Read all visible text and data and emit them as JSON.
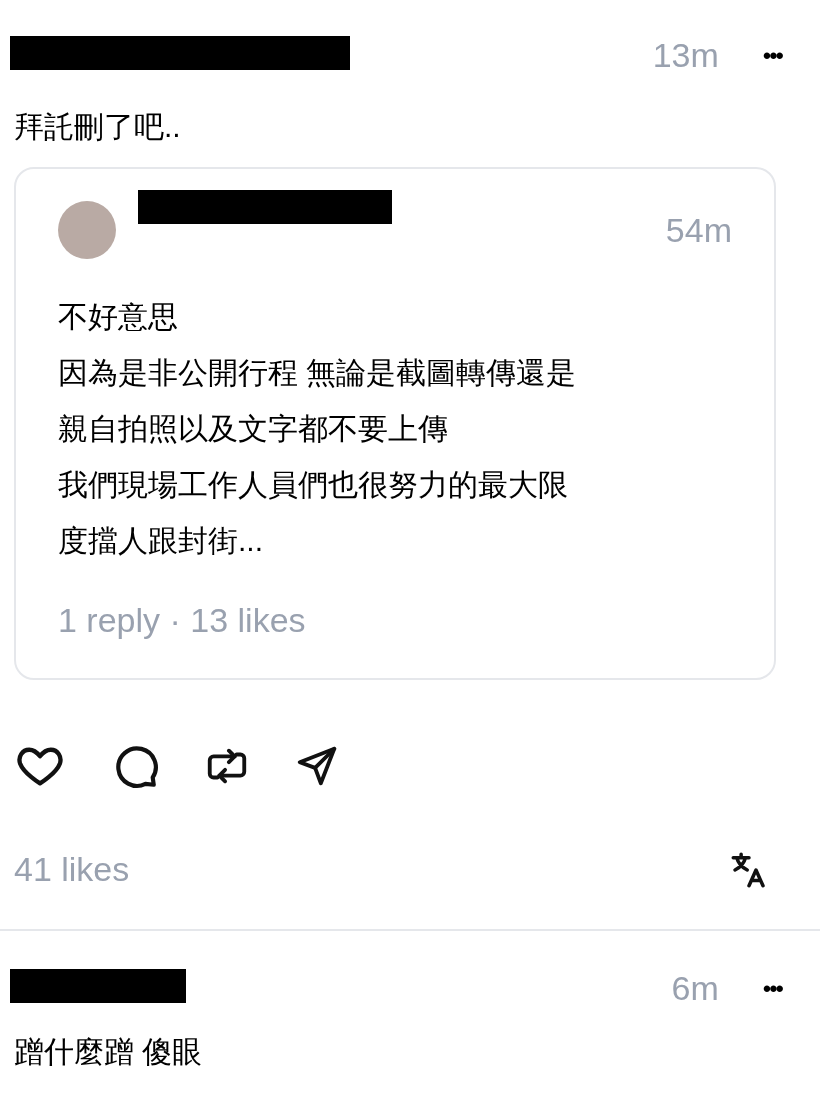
{
  "posts": [
    {
      "redacted": true,
      "time": "13m",
      "more": "•••",
      "text": "拜託刪了吧..",
      "quote": {
        "redacted": true,
        "time": "54m",
        "lines": [
          "不好意思",
          "因為是非公開行程 無論是截圖轉傳還是",
          "親自拍照以及文字都不要上傳",
          "我們現場工作人員們也很努力的最大限",
          "度擋人跟封街..."
        ],
        "stats": "1 reply · 13 likes"
      },
      "likes": "41 likes"
    },
    {
      "redacted": true,
      "time": "6m",
      "more": "•••",
      "text": "蹭什麼蹭 傻眼"
    }
  ]
}
